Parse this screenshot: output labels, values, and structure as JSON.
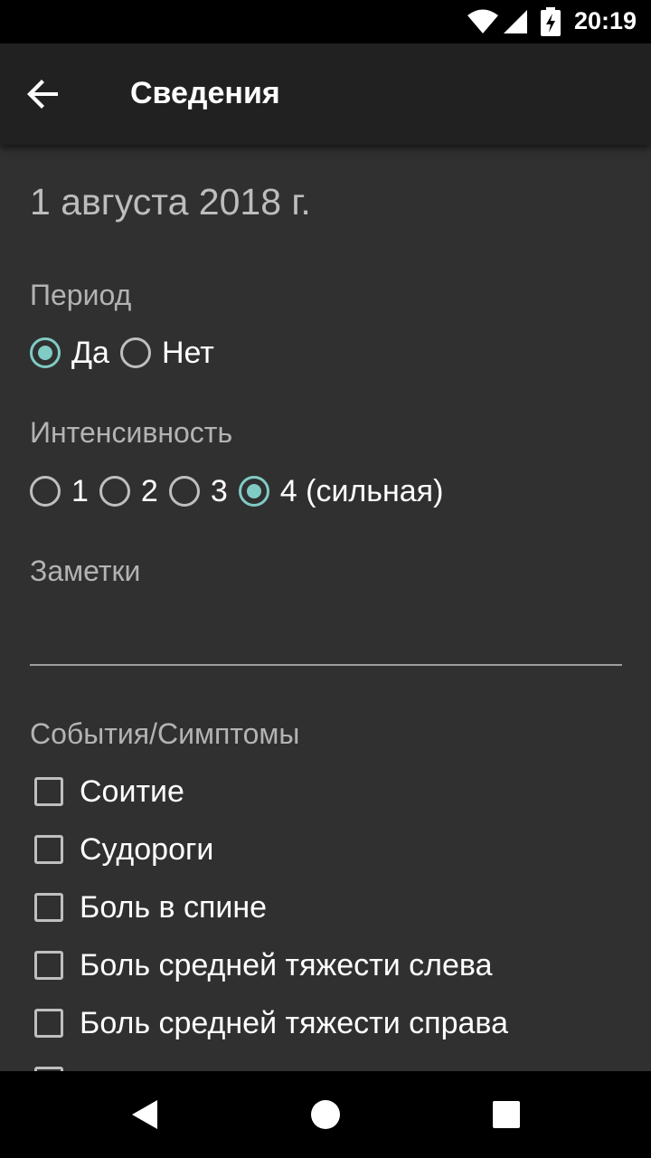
{
  "status_bar": {
    "time": "20:19"
  },
  "app_bar": {
    "title": "Сведения"
  },
  "date": "1 августа 2018 г.",
  "period": {
    "label": "Период",
    "options": [
      "Да",
      "Нет"
    ],
    "selected": "Да"
  },
  "intensity": {
    "label": "Интенсивность",
    "options": [
      "1",
      "2",
      "3",
      "4 (сильная)"
    ],
    "selected": "4 (сильная)"
  },
  "notes": {
    "label": "Заметки",
    "value": ""
  },
  "events": {
    "label": "События/Симптомы",
    "items": [
      "Соитие",
      "Судороги",
      "Боль в спине",
      "Боль средней тяжести слева",
      "Боль средней тяжести справа"
    ]
  },
  "colors": {
    "accent": "#80cbc4",
    "background": "#303030",
    "app_bar": "#212121"
  }
}
